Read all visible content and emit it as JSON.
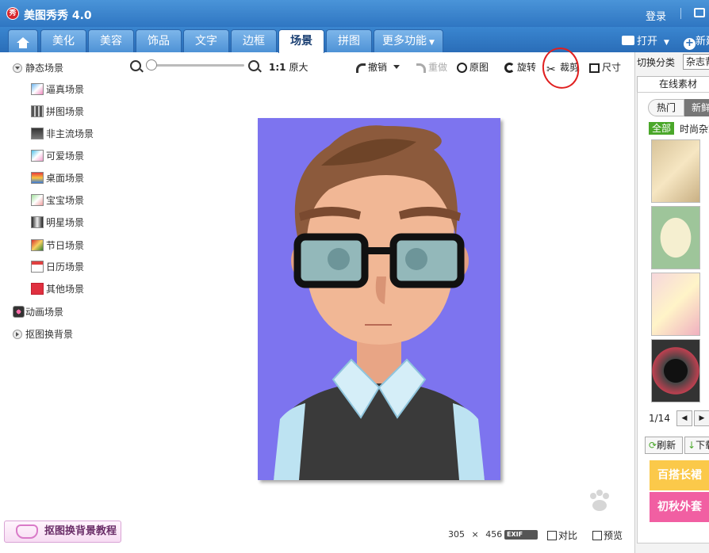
{
  "app": {
    "title": "美图秀秀 4.0",
    "logo_text": "秀",
    "login": "登录"
  },
  "tabs": [
    "美化",
    "美容",
    "饰品",
    "文字",
    "边框",
    "场景",
    "拼图",
    "更多功能"
  ],
  "active_tab": "场景",
  "header_actions": {
    "open": "打开",
    "new": "新建"
  },
  "left_tree": {
    "static": "静态场景",
    "items": [
      "逼真场景",
      "拼图场景",
      "非主流场景",
      "可爱场景",
      "桌面场景",
      "宝宝场景",
      "明星场景",
      "节日场景",
      "日历场景",
      "其他场景"
    ],
    "animated": "动画场景",
    "cutout": "抠图换背景"
  },
  "tutorial_button": "抠图换背景教程",
  "toolbar": {
    "original_size": "原大",
    "ratio": "1:1",
    "zoom_level": 0,
    "undo": "撤销",
    "redo": "重做",
    "reset": "原图",
    "rotate": "旋转",
    "crop": "裁剪",
    "resize": "尺寸"
  },
  "status": {
    "width": "305",
    "times": "×",
    "height": "456",
    "exif": "EXIF",
    "compare": "对比",
    "preview": "预览"
  },
  "right_panel": {
    "switch_label": "切换分类",
    "switch_value": "杂志背景",
    "online_tab": "在线素材",
    "hot": "热门",
    "new": "新鲜",
    "all": "全部",
    "fashion": "时尚杂志",
    "page": "1/14",
    "refresh": "刷新",
    "download": "下载",
    "banner1": "百搭长裙",
    "banner2": "初秋外套"
  },
  "colors": {
    "accent": "#2f76c2",
    "canvas_bg": "#7d74ef",
    "crop_circle": "#e02020"
  }
}
